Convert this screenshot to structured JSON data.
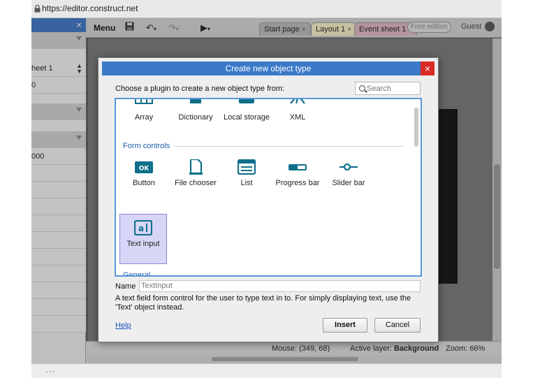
{
  "browser": {
    "url": "https://editor.construct.net"
  },
  "left_panel": {
    "rows": [
      "",
      "",
      "heet 1",
      "0",
      "",
      "",
      "000",
      "",
      "",
      "",
      "",
      "",
      ""
    ]
  },
  "toolbar": {
    "menu_label": "Menu",
    "tabs": [
      {
        "label": "Start page"
      },
      {
        "label": "Layout 1"
      },
      {
        "label": "Event sheet 1"
      }
    ],
    "tab_close": "×",
    "free_badge": "Free edition",
    "user": "Guest"
  },
  "status_bar": {
    "mouse": "Mouse: (349, 68)",
    "layer_label": "Active layer:",
    "layer_value": "Background",
    "zoom": "Zoom: 66%"
  },
  "dialog": {
    "title": "Create new object type",
    "close": "×",
    "prompt": "Choose a plugin to create a new object type from:",
    "search_placeholder": "Search",
    "top_row": [
      "Array",
      "Dictionary",
      "Local storage",
      "XML"
    ],
    "section_form": "Form controls",
    "form_controls": [
      "Button",
      "File chooser",
      "List",
      "Progress bar",
      "Slider bar"
    ],
    "selected": "Text input",
    "section_general": "General",
    "name_label": "Name",
    "name_value": "TextInput",
    "description": "A text field form control for the user to type text in to. For simply displaying text, use the 'Text' object instead.",
    "help": "Help",
    "insert": "Insert",
    "cancel": "Cancel"
  },
  "colors": {
    "title_bar": "#3b7ac9",
    "close_red": "#d92b25",
    "icon_teal": "#0f6f8a",
    "section_blue": "#1e5ea8",
    "selection": "#d8d6f6"
  }
}
